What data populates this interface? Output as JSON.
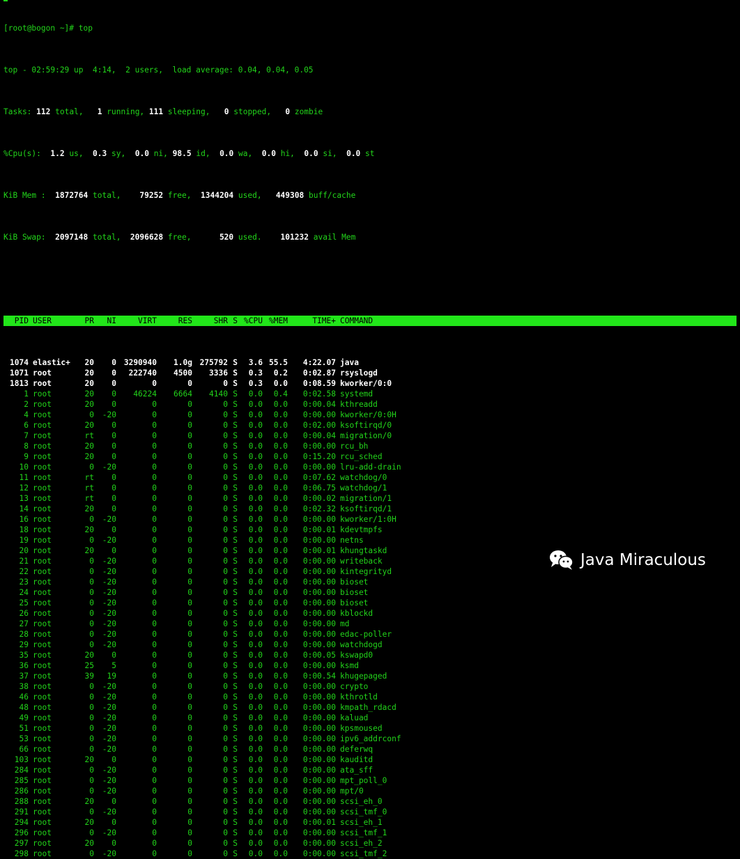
{
  "prompt": "[root@bogon ~]# top",
  "summary": {
    "top": {
      "text": "top - 02:59:29 up  4:14,  2 users,  load average: 0.04, 0.04, 0.05"
    },
    "tasks": {
      "label": "Tasks:",
      "total": "112",
      "total_label": "total,",
      "running": "1",
      "running_label": "running,",
      "sleeping": "111",
      "sleeping_label": "sleeping,",
      "stopped": "0",
      "stopped_label": "stopped,",
      "zombie": "0",
      "zombie_label": "zombie"
    },
    "cpu": {
      "label": "%Cpu(s):",
      "us": "1.2",
      "us_label": "us,",
      "sy": "0.3",
      "sy_label": "sy,",
      "ni": "0.0",
      "ni_label": "ni,",
      "id": "98.5",
      "id_label": "id,",
      "wa": "0.0",
      "wa_label": "wa,",
      "hi": "0.0",
      "hi_label": "hi,",
      "si": "0.0",
      "si_label": "si,",
      "st": "0.0",
      "st_label": "st"
    },
    "mem": {
      "label": "KiB Mem :",
      "total": "1872764",
      "total_label": "total,",
      "free": "79252",
      "free_label": "free,",
      "used": "1344204",
      "used_label": "used,",
      "buff": "449308",
      "buff_label": "buff/cache"
    },
    "swap": {
      "label": "KiB Swap:",
      "total": "2097148",
      "total_label": "total,",
      "free": "2096628",
      "free_label": "free,",
      "used": "520",
      "used_label": "used.",
      "avail": "101232",
      "avail_label": "avail Mem"
    }
  },
  "columns": [
    "PID",
    "USER",
    "PR",
    "NI",
    "VIRT",
    "RES",
    "SHR",
    "S",
    "%CPU",
    "%MEM",
    "TIME+",
    "COMMAND"
  ],
  "processes": [
    [
      "1074",
      "elastic+",
      "20",
      "0",
      "3290940",
      "1.0g",
      "275792",
      "S",
      "3.6",
      "55.5",
      "4:22.07",
      "java"
    ],
    [
      "1071",
      "root",
      "20",
      "0",
      "222740",
      "4500",
      "3336",
      "S",
      "0.3",
      "0.2",
      "0:02.87",
      "rsyslogd"
    ],
    [
      "1813",
      "root",
      "20",
      "0",
      "0",
      "0",
      "0",
      "S",
      "0.3",
      "0.0",
      "0:08.59",
      "kworker/0:0"
    ],
    [
      "1",
      "root",
      "20",
      "0",
      "46224",
      "6664",
      "4140",
      "S",
      "0.0",
      "0.4",
      "0:02.58",
      "systemd"
    ],
    [
      "2",
      "root",
      "20",
      "0",
      "0",
      "0",
      "0",
      "S",
      "0.0",
      "0.0",
      "0:00.04",
      "kthreadd"
    ],
    [
      "4",
      "root",
      "0",
      "-20",
      "0",
      "0",
      "0",
      "S",
      "0.0",
      "0.0",
      "0:00.00",
      "kworker/0:0H"
    ],
    [
      "6",
      "root",
      "20",
      "0",
      "0",
      "0",
      "0",
      "S",
      "0.0",
      "0.0",
      "0:02.00",
      "ksoftirqd/0"
    ],
    [
      "7",
      "root",
      "rt",
      "0",
      "0",
      "0",
      "0",
      "S",
      "0.0",
      "0.0",
      "0:00.04",
      "migration/0"
    ],
    [
      "8",
      "root",
      "20",
      "0",
      "0",
      "0",
      "0",
      "S",
      "0.0",
      "0.0",
      "0:00.00",
      "rcu_bh"
    ],
    [
      "9",
      "root",
      "20",
      "0",
      "0",
      "0",
      "0",
      "S",
      "0.0",
      "0.0",
      "0:15.20",
      "rcu_sched"
    ],
    [
      "10",
      "root",
      "0",
      "-20",
      "0",
      "0",
      "0",
      "S",
      "0.0",
      "0.0",
      "0:00.00",
      "lru-add-drain"
    ],
    [
      "11",
      "root",
      "rt",
      "0",
      "0",
      "0",
      "0",
      "S",
      "0.0",
      "0.0",
      "0:07.62",
      "watchdog/0"
    ],
    [
      "12",
      "root",
      "rt",
      "0",
      "0",
      "0",
      "0",
      "S",
      "0.0",
      "0.0",
      "0:06.75",
      "watchdog/1"
    ],
    [
      "13",
      "root",
      "rt",
      "0",
      "0",
      "0",
      "0",
      "S",
      "0.0",
      "0.0",
      "0:00.02",
      "migration/1"
    ],
    [
      "14",
      "root",
      "20",
      "0",
      "0",
      "0",
      "0",
      "S",
      "0.0",
      "0.0",
      "0:02.32",
      "ksoftirqd/1"
    ],
    [
      "16",
      "root",
      "0",
      "-20",
      "0",
      "0",
      "0",
      "S",
      "0.0",
      "0.0",
      "0:00.00",
      "kworker/1:0H"
    ],
    [
      "18",
      "root",
      "20",
      "0",
      "0",
      "0",
      "0",
      "S",
      "0.0",
      "0.0",
      "0:00.01",
      "kdevtmpfs"
    ],
    [
      "19",
      "root",
      "0",
      "-20",
      "0",
      "0",
      "0",
      "S",
      "0.0",
      "0.0",
      "0:00.00",
      "netns"
    ],
    [
      "20",
      "root",
      "20",
      "0",
      "0",
      "0",
      "0",
      "S",
      "0.0",
      "0.0",
      "0:00.01",
      "khungtaskd"
    ],
    [
      "21",
      "root",
      "0",
      "-20",
      "0",
      "0",
      "0",
      "S",
      "0.0",
      "0.0",
      "0:00.00",
      "writeback"
    ],
    [
      "22",
      "root",
      "0",
      "-20",
      "0",
      "0",
      "0",
      "S",
      "0.0",
      "0.0",
      "0:00.00",
      "kintegrityd"
    ],
    [
      "23",
      "root",
      "0",
      "-20",
      "0",
      "0",
      "0",
      "S",
      "0.0",
      "0.0",
      "0:00.00",
      "bioset"
    ],
    [
      "24",
      "root",
      "0",
      "-20",
      "0",
      "0",
      "0",
      "S",
      "0.0",
      "0.0",
      "0:00.00",
      "bioset"
    ],
    [
      "25",
      "root",
      "0",
      "-20",
      "0",
      "0",
      "0",
      "S",
      "0.0",
      "0.0",
      "0:00.00",
      "bioset"
    ],
    [
      "26",
      "root",
      "0",
      "-20",
      "0",
      "0",
      "0",
      "S",
      "0.0",
      "0.0",
      "0:00.00",
      "kblockd"
    ],
    [
      "27",
      "root",
      "0",
      "-20",
      "0",
      "0",
      "0",
      "S",
      "0.0",
      "0.0",
      "0:00.00",
      "md"
    ],
    [
      "28",
      "root",
      "0",
      "-20",
      "0",
      "0",
      "0",
      "S",
      "0.0",
      "0.0",
      "0:00.00",
      "edac-poller"
    ],
    [
      "29",
      "root",
      "0",
      "-20",
      "0",
      "0",
      "0",
      "S",
      "0.0",
      "0.0",
      "0:00.00",
      "watchdogd"
    ],
    [
      "35",
      "root",
      "20",
      "0",
      "0",
      "0",
      "0",
      "S",
      "0.0",
      "0.0",
      "0:00.05",
      "kswapd0"
    ],
    [
      "36",
      "root",
      "25",
      "5",
      "0",
      "0",
      "0",
      "S",
      "0.0",
      "0.0",
      "0:00.00",
      "ksmd"
    ],
    [
      "37",
      "root",
      "39",
      "19",
      "0",
      "0",
      "0",
      "S",
      "0.0",
      "0.0",
      "0:00.54",
      "khugepaged"
    ],
    [
      "38",
      "root",
      "0",
      "-20",
      "0",
      "0",
      "0",
      "S",
      "0.0",
      "0.0",
      "0:00.00",
      "crypto"
    ],
    [
      "46",
      "root",
      "0",
      "-20",
      "0",
      "0",
      "0",
      "S",
      "0.0",
      "0.0",
      "0:00.00",
      "kthrotld"
    ],
    [
      "48",
      "root",
      "0",
      "-20",
      "0",
      "0",
      "0",
      "S",
      "0.0",
      "0.0",
      "0:00.00",
      "kmpath_rdacd"
    ],
    [
      "49",
      "root",
      "0",
      "-20",
      "0",
      "0",
      "0",
      "S",
      "0.0",
      "0.0",
      "0:00.00",
      "kaluad"
    ],
    [
      "51",
      "root",
      "0",
      "-20",
      "0",
      "0",
      "0",
      "S",
      "0.0",
      "0.0",
      "0:00.00",
      "kpsmoused"
    ],
    [
      "53",
      "root",
      "0",
      "-20",
      "0",
      "0",
      "0",
      "S",
      "0.0",
      "0.0",
      "0:00.00",
      "ipv6_addrconf"
    ],
    [
      "66",
      "root",
      "0",
      "-20",
      "0",
      "0",
      "0",
      "S",
      "0.0",
      "0.0",
      "0:00.00",
      "deferwq"
    ],
    [
      "103",
      "root",
      "20",
      "0",
      "0",
      "0",
      "0",
      "S",
      "0.0",
      "0.0",
      "0:00.00",
      "kauditd"
    ],
    [
      "284",
      "root",
      "0",
      "-20",
      "0",
      "0",
      "0",
      "S",
      "0.0",
      "0.0",
      "0:00.00",
      "ata_sff"
    ],
    [
      "285",
      "root",
      "0",
      "-20",
      "0",
      "0",
      "0",
      "S",
      "0.0",
      "0.0",
      "0:00.00",
      "mpt_poll_0"
    ],
    [
      "286",
      "root",
      "0",
      "-20",
      "0",
      "0",
      "0",
      "S",
      "0.0",
      "0.0",
      "0:00.00",
      "mpt/0"
    ],
    [
      "288",
      "root",
      "20",
      "0",
      "0",
      "0",
      "0",
      "S",
      "0.0",
      "0.0",
      "0:00.00",
      "scsi_eh_0"
    ],
    [
      "291",
      "root",
      "0",
      "-20",
      "0",
      "0",
      "0",
      "S",
      "0.0",
      "0.0",
      "0:00.00",
      "scsi_tmf_0"
    ],
    [
      "294",
      "root",
      "20",
      "0",
      "0",
      "0",
      "0",
      "S",
      "0.0",
      "0.0",
      "0:00.01",
      "scsi_eh_1"
    ],
    [
      "296",
      "root",
      "0",
      "-20",
      "0",
      "0",
      "0",
      "S",
      "0.0",
      "0.0",
      "0:00.00",
      "scsi_tmf_1"
    ],
    [
      "297",
      "root",
      "20",
      "0",
      "0",
      "0",
      "0",
      "S",
      "0.0",
      "0.0",
      "0:00.00",
      "scsi_eh_2"
    ],
    [
      "298",
      "root",
      "0",
      "-20",
      "0",
      "0",
      "0",
      "S",
      "0.0",
      "0.0",
      "0:00.00",
      "scsi_tmf_2"
    ]
  ],
  "hot_rows": 3,
  "watermark": {
    "icon": "wechat-icon",
    "text": "Java Miraculous"
  },
  "colors": {
    "foreground": "#22d31a",
    "header_bar": "#22e61a",
    "background": "#000000"
  }
}
